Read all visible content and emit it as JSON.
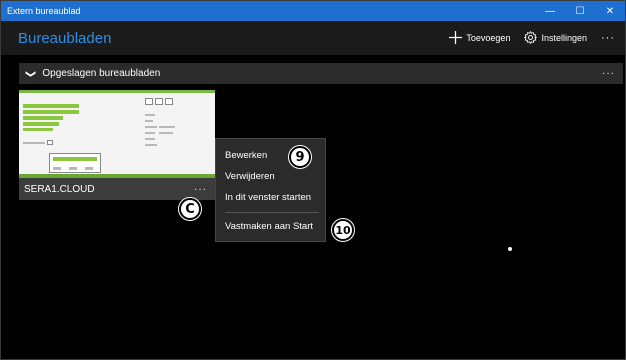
{
  "window": {
    "title": "Extern bureaublad",
    "minimize_glyph": "—",
    "maximize_glyph": "☐",
    "close_glyph": "✕"
  },
  "header": {
    "page_title": "Bureaubladen",
    "add_label": "Toevoegen",
    "add_icon": "plus-icon",
    "settings_label": "Instellingen",
    "settings_icon": "gear-icon",
    "more_glyph": "···"
  },
  "group": {
    "label": "Opgeslagen bureaubladen",
    "chevron_glyph": "❯",
    "more_glyph": "···"
  },
  "tile": {
    "name": "SERA1.CLOUD",
    "more_glyph": "···"
  },
  "context_menu": {
    "items": [
      "Bewerken",
      "Verwijderen",
      "In dit venster starten",
      "Vastmaken aan Start"
    ]
  },
  "callouts": {
    "c": "C",
    "nine": "9",
    "ten": "10"
  }
}
